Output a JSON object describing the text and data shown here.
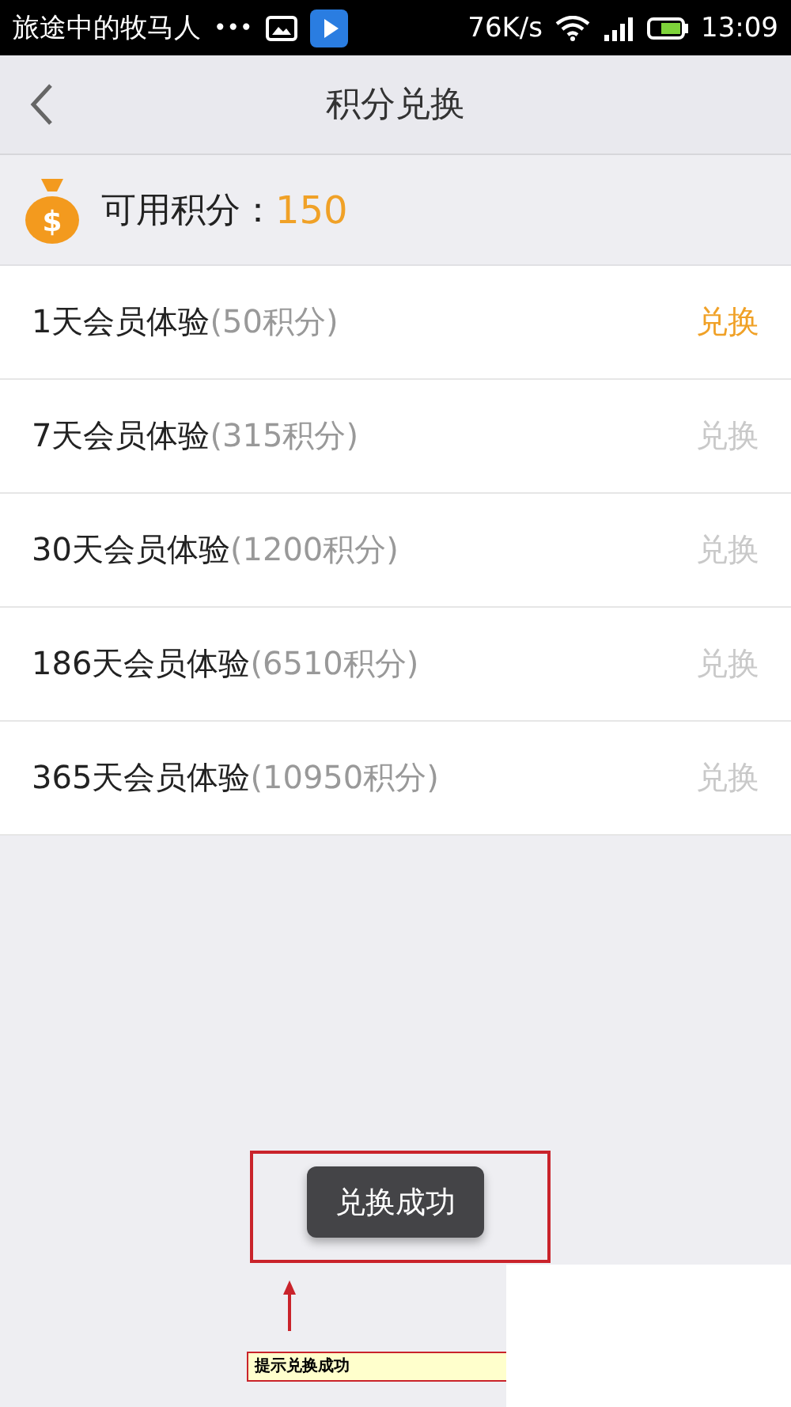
{
  "status_bar": {
    "notification": "旅途中的牧马人",
    "more": "•••",
    "speed": "76K/s",
    "time": "13:09"
  },
  "nav": {
    "title": "积分兑换"
  },
  "balance": {
    "icon_symbol": "$",
    "label": "可用积分：",
    "value": "150"
  },
  "items": [
    {
      "name": "1天会员体验",
      "points": "(50积分)",
      "action": "兑换",
      "disabled": false
    },
    {
      "name": "7天会员体验",
      "points": "(315积分)",
      "action": "兑换",
      "disabled": true
    },
    {
      "name": "30天会员体验",
      "points": "(1200积分)",
      "action": "兑换",
      "disabled": true
    },
    {
      "name": "186天会员体验",
      "points": "(6510积分)",
      "action": "兑换",
      "disabled": true
    },
    {
      "name": "365天会员体验",
      "points": "(10950积分)",
      "action": "兑换",
      "disabled": true
    }
  ],
  "toast": "兑换成功",
  "annotation": {
    "note": "提示兑换成功"
  }
}
